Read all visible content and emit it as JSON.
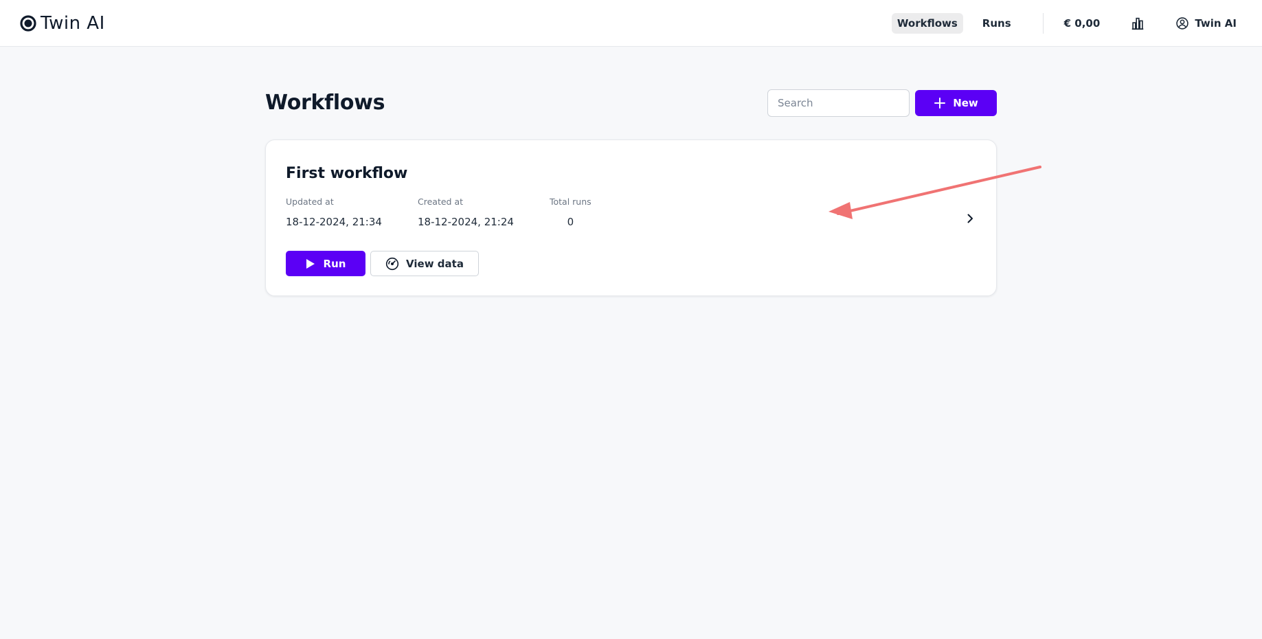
{
  "app": {
    "name": "Twin AI"
  },
  "nav": {
    "tabs": [
      {
        "label": "Workflows",
        "active": true
      },
      {
        "label": "Runs",
        "active": false
      }
    ],
    "balance": "€ 0,00",
    "account_name": "Twin AI"
  },
  "page": {
    "title": "Workflows",
    "search_placeholder": "Search",
    "new_label": "New"
  },
  "workflow": {
    "title": "First workflow",
    "updated_label": "Updated at",
    "updated_value": "18-12-2024, 21:34",
    "created_label": "Created at",
    "created_value": "18-12-2024, 21:24",
    "runs_label": "Total runs",
    "runs_value": "0",
    "run_label": "Run",
    "view_label": "View data"
  },
  "colors": {
    "accent": "#5b00f5",
    "annotation": "#f07373"
  }
}
